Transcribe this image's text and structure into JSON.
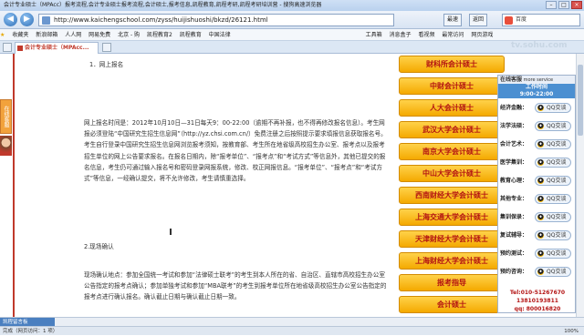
{
  "window": {
    "title": "会计专业硕士（MPAcc）报考流程,会计专业硕士报考流程,会计硕士,报考信息,凯程教育,凯程考研,凯程考研培训营 - 搜狗高速浏览器"
  },
  "navbar": {
    "back_icon": "back-arrow-icon",
    "forward_icon": "forward-arrow-icon",
    "url": "http://www.kaichengschool.com/zyss/huijishuoshi/bkzd/26121.html",
    "btn_speed": "最速",
    "btn_back": "返回",
    "search_placeholder": "百度"
  },
  "favorites": {
    "items": [
      "收藏夹",
      "新浪邮箱",
      "人人网",
      "网易免费",
      "北京 - 购",
      "凯程教育2",
      "凯程教育",
      "中国法律",
      "工具箱",
      "消息盒子",
      "看视频",
      "最常访问",
      "网页游戏"
    ]
  },
  "tab": {
    "label": "会计专业硕士（MPAcc...",
    "close_icon": "close-icon"
  },
  "sidebadge": {
    "label": "在线客服"
  },
  "content": {
    "sec1_heading": "1．网上报名",
    "sec1_body": "网上报名时间是：2012年10月10日—31日每天9：00-22:00（逾期不再补报，也不得再修改报名信息）。考生网报必须登陆“中国研究生招生信息网”（http://yz.chsi.com.cn/）免费注册之后按照提示要求填报信息获取报名号。考生自行登录中国研究生招生信息网浏览报考须知，按教育部、考生所在地省级高校招生办公室、报考点以及报考招生单位的网上公告要求报名。在报名日期内，除“报考单位”、“报考点”和“考试方式”等信息外，其他已提交的报名信息，考生仍可通过输入报名号和密码登录网报系统，修改、校正网报信息。“报考单位”、“报考点”和“考试方式”等信息，一经确认提交，将不允许修改，考生请慎重选择。",
    "sec2_heading": "2.现场确认",
    "sec2_body": "现场确认地点：参加全国统一考试和参加“法律硕士联考”的考生到本人所在的省、自治区、直辖市高校招生办公室公告指定的报考点确认；参加单独考试和参加“MBA联考”的考生到报考单位所在地省级高校招生办公室公告指定的报考点进行确认报名。确认截止日期与确认截止日期一致。"
  },
  "buttons": [
    "财科所会计硕士",
    "中财会计硕士",
    "人大会计硕士",
    "武汉大学会计硕士",
    "南京大学会计硕士",
    "中山大学会计硕士",
    "西南财经大学会计硕士",
    "上海交通大学会计硕士",
    "天津财经大学会计硕士",
    "上海财经大学会计硕士",
    "报考指导",
    "会计硕士"
  ],
  "service": {
    "header": "在线客服",
    "header_sub": "more service",
    "hours_label": "工作时间",
    "hours": "9:00-22:00",
    "rows": [
      {
        "label": "经济金融：",
        "qq": "QQ交谈"
      },
      {
        "label": "法学法硕：",
        "qq": "QQ交谈"
      },
      {
        "label": "会计艺术：",
        "qq": "QQ交谈"
      },
      {
        "label": "医学集训：",
        "qq": "QQ交谈"
      },
      {
        "label": "教育心理：",
        "qq": "QQ交谈"
      },
      {
        "label": "其他专业：",
        "qq": "QQ交谈"
      },
      {
        "label": "集训保录：",
        "qq": "QQ交谈"
      },
      {
        "label": "复试辅导：",
        "qq": "QQ交谈"
      },
      {
        "label": "预约测试：",
        "qq": "QQ交谈"
      },
      {
        "label": "预约咨询：",
        "qq": "QQ交谈"
      }
    ],
    "tel": "Tel:010-51267670",
    "phone": "13810193811",
    "qq": "qq: 800016820"
  },
  "watermark": "tv.sohu.com",
  "bottom": {
    "tab": "凯程留言板"
  },
  "status": {
    "left": "完成（网页访问：1 项）",
    "right": "100%"
  }
}
